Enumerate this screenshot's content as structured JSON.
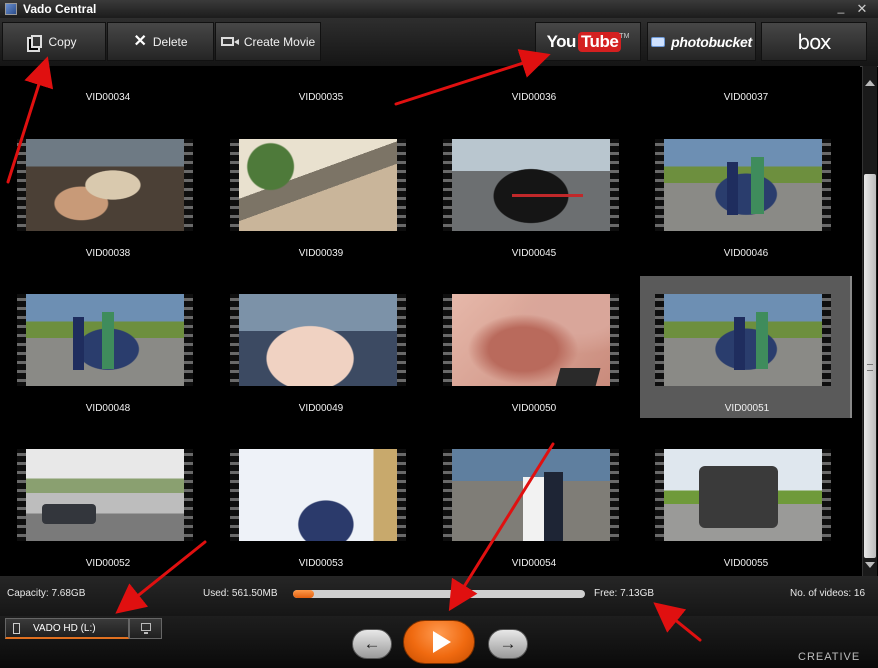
{
  "window": {
    "title": "Vado Central",
    "minimize": "_",
    "close": "✕"
  },
  "toolbar": {
    "copy_label": "Copy",
    "delete_label": "Delete",
    "create_movie_label": "Create Movie",
    "youtube": {
      "you": "You",
      "tube": "Tube",
      "tm": "TM"
    },
    "photobucket_label": "photobucket",
    "box_label": "box"
  },
  "videos": [
    {
      "name": "VID00034"
    },
    {
      "name": "VID00035"
    },
    {
      "name": "VID00036"
    },
    {
      "name": "VID00037"
    },
    {
      "name": "VID00038"
    },
    {
      "name": "VID00039"
    },
    {
      "name": "VID00045"
    },
    {
      "name": "VID00046"
    },
    {
      "name": "VID00048"
    },
    {
      "name": "VID00049"
    },
    {
      "name": "VID00050"
    },
    {
      "name": "VID00051",
      "selected": true
    },
    {
      "name": "VID00052"
    },
    {
      "name": "VID00053"
    },
    {
      "name": "VID00054"
    },
    {
      "name": "VID00055"
    }
  ],
  "status": {
    "capacity": "Capacity: 7.68GB",
    "used": "Used: 561.50MB",
    "used_fraction": 0.073,
    "free": "Free: 7.13GB",
    "count": "No. of videos: 16"
  },
  "device": {
    "label": "VADO HD (L:)"
  },
  "brand": "CREATIVE",
  "colors": {
    "accent": "#f06a10",
    "annotation": "#e01010"
  }
}
